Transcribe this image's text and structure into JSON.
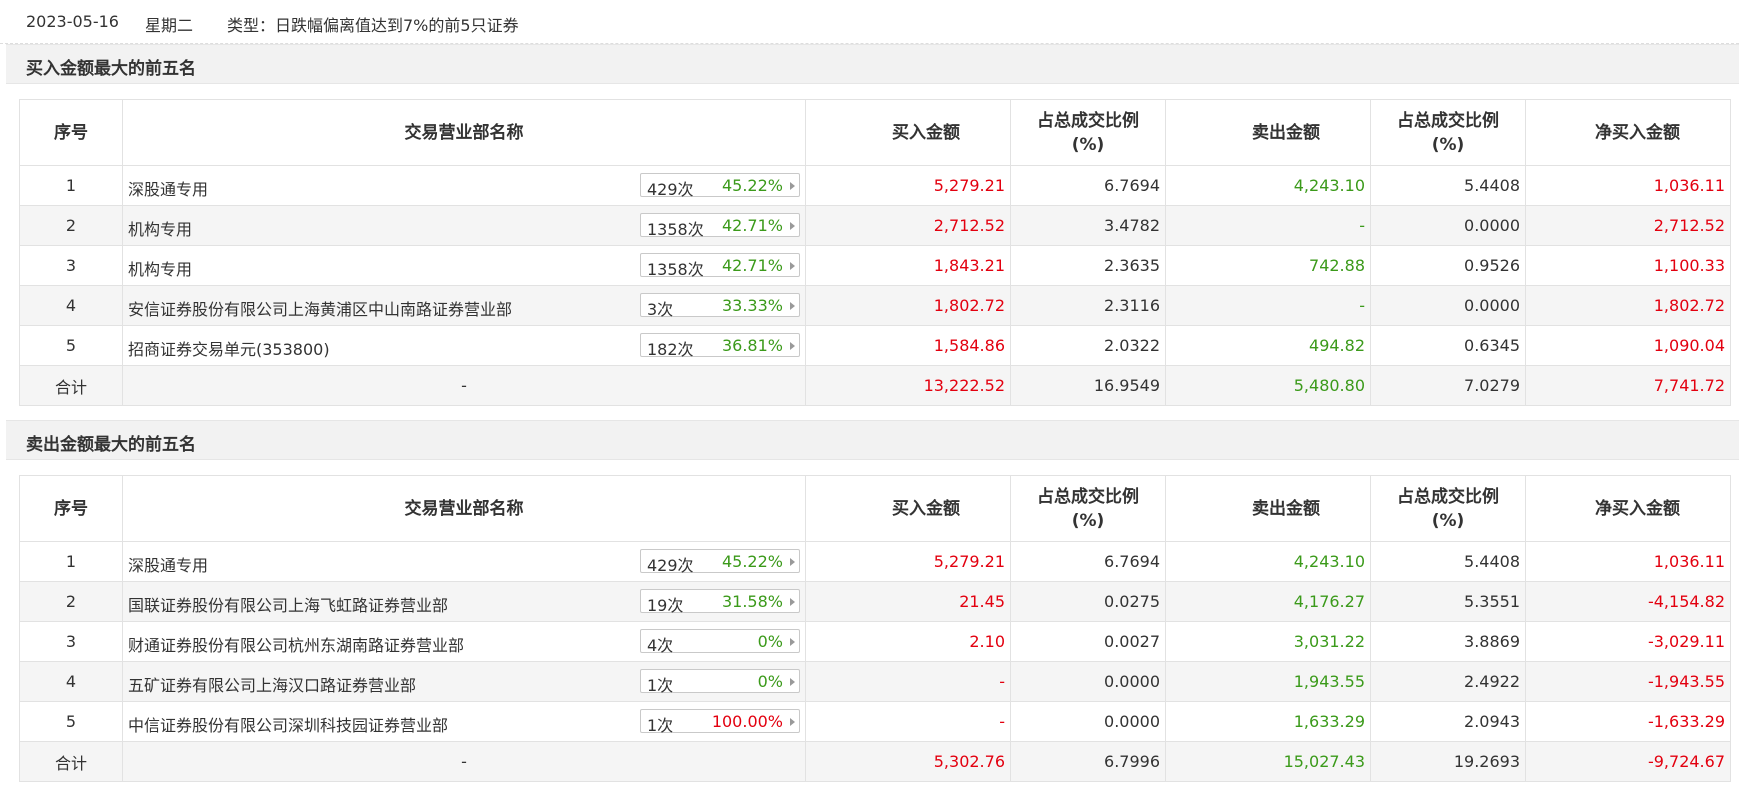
{
  "header": {
    "date": "2023-05-16",
    "weekday": "星期二",
    "type_label": "类型：日跌幅偏离值达到7%的前5只证券"
  },
  "columns": [
    "序号",
    "交易营业部名称",
    "买入金额",
    "占总成交比例\n(%)",
    "卖出金额",
    "占总成交比例\n(%)",
    "净买入金额"
  ],
  "colors": {
    "buy": "#e3000f",
    "sell": "#3b9a1a",
    "section_bg": "#f2f2f2"
  },
  "buy_section": {
    "title": "买入金额最大的前五名",
    "rows": [
      {
        "no": "1",
        "name": "深股通专用",
        "count": "429次",
        "pct": "45.22%",
        "pct_color": "green",
        "buy": "5,279.21",
        "buy_ratio": "6.7694",
        "sell": "4,243.10",
        "sell_ratio": "5.4408",
        "net": "1,036.11"
      },
      {
        "no": "2",
        "name": "机构专用",
        "count": "1358次",
        "pct": "42.71%",
        "pct_color": "green",
        "buy": "2,712.52",
        "buy_ratio": "3.4782",
        "sell": "-",
        "sell_ratio": "0.0000",
        "net": "2,712.52"
      },
      {
        "no": "3",
        "name": "机构专用",
        "count": "1358次",
        "pct": "42.71%",
        "pct_color": "green",
        "buy": "1,843.21",
        "buy_ratio": "2.3635",
        "sell": "742.88",
        "sell_ratio": "0.9526",
        "net": "1,100.33"
      },
      {
        "no": "4",
        "name": "安信证券股份有限公司上海黄浦区中山南路证券营业部",
        "count": "3次",
        "pct": "33.33%",
        "pct_color": "green",
        "buy": "1,802.72",
        "buy_ratio": "2.3116",
        "sell": "-",
        "sell_ratio": "0.0000",
        "net": "1,802.72"
      },
      {
        "no": "5",
        "name": "招商证券交易单元(353800)",
        "count": "182次",
        "pct": "36.81%",
        "pct_color": "green",
        "buy": "1,584.86",
        "buy_ratio": "2.0322",
        "sell": "494.82",
        "sell_ratio": "0.6345",
        "net": "1,090.04"
      }
    ],
    "total": {
      "label": "合计",
      "name": "-",
      "buy": "13,222.52",
      "buy_ratio": "16.9549",
      "sell": "5,480.80",
      "sell_ratio": "7.0279",
      "net": "7,741.72"
    }
  },
  "sell_section": {
    "title": "卖出金额最大的前五名",
    "rows": [
      {
        "no": "1",
        "name": "深股通专用",
        "count": "429次",
        "pct": "45.22%",
        "pct_color": "green",
        "buy": "5,279.21",
        "buy_ratio": "6.7694",
        "sell": "4,243.10",
        "sell_ratio": "5.4408",
        "net": "1,036.11"
      },
      {
        "no": "2",
        "name": "国联证券股份有限公司上海飞虹路证券营业部",
        "count": "19次",
        "pct": "31.58%",
        "pct_color": "green",
        "buy": "21.45",
        "buy_ratio": "0.0275",
        "sell": "4,176.27",
        "sell_ratio": "5.3551",
        "net": "-4,154.82"
      },
      {
        "no": "3",
        "name": "财通证券股份有限公司杭州东湖南路证券营业部",
        "count": "4次",
        "pct": "0%",
        "pct_color": "green",
        "buy": "2.10",
        "buy_ratio": "0.0027",
        "sell": "3,031.22",
        "sell_ratio": "3.8869",
        "net": "-3,029.11"
      },
      {
        "no": "4",
        "name": "五矿证券有限公司上海汉口路证券营业部",
        "count": "1次",
        "pct": "0%",
        "pct_color": "green",
        "buy": "-",
        "buy_ratio": "0.0000",
        "sell": "1,943.55",
        "sell_ratio": "2.4922",
        "net": "-1,943.55"
      },
      {
        "no": "5",
        "name": "中信证券股份有限公司深圳科技园证券营业部",
        "count": "1次",
        "pct": "100.00%",
        "pct_color": "red",
        "buy": "-",
        "buy_ratio": "0.0000",
        "sell": "1,633.29",
        "sell_ratio": "2.0943",
        "net": "-1,633.29"
      }
    ],
    "total": {
      "label": "合计",
      "name": "-",
      "buy": "5,302.76",
      "buy_ratio": "6.7996",
      "sell": "15,027.43",
      "sell_ratio": "19.2693",
      "net": "-9,724.67"
    }
  }
}
